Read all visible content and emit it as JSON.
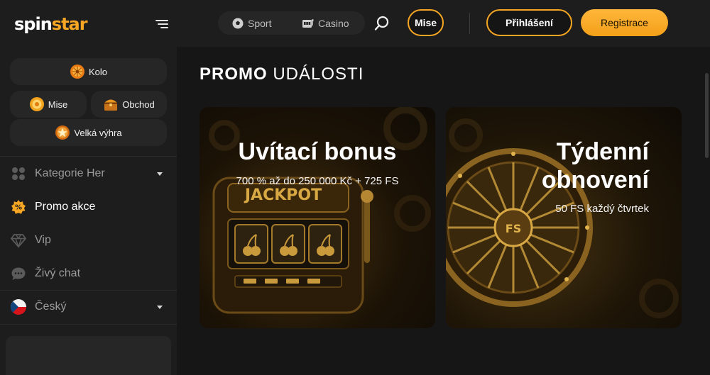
{
  "header": {
    "logo": {
      "part1": "spin",
      "part2": "star"
    },
    "nav": {
      "sport_label": "Sport",
      "casino_label": "Casino"
    },
    "mise_label": "Mise",
    "login_label": "Přihlášení",
    "register_label": "Registrace"
  },
  "sidebar": {
    "pills": {
      "kolo": "Kolo",
      "mise": "Mise",
      "obchod": "Obchod",
      "velka_vyhra": "Velká výhra"
    },
    "nav": [
      {
        "label": "Kategorie Her",
        "icon": "grid-dots-icon",
        "active": false
      },
      {
        "label": "Promo akce",
        "icon": "promo-badge-icon",
        "active": true
      },
      {
        "label": "Vip",
        "icon": "diamond-icon",
        "active": false
      },
      {
        "label": "Živý chat",
        "icon": "chat-icon",
        "active": false
      }
    ],
    "language": {
      "label": "Český",
      "icon": "czech-flag-icon"
    }
  },
  "main": {
    "title_bold": "PROMO",
    "title_rest": "UDÁLOSTI",
    "cards": [
      {
        "title": "Uvítací bonus",
        "subtitle": "700 % až do 250 000 Kč + 725 FS",
        "art_text": "JACKPOT"
      },
      {
        "title_line1": "Týdenní",
        "title_line2": "obnovení",
        "subtitle": "50 FS každý čtvrtek",
        "art_text": "FS"
      }
    ]
  },
  "colors": {
    "accent": "#f6a623",
    "background": "#161616",
    "panel": "#1d1d1d"
  }
}
